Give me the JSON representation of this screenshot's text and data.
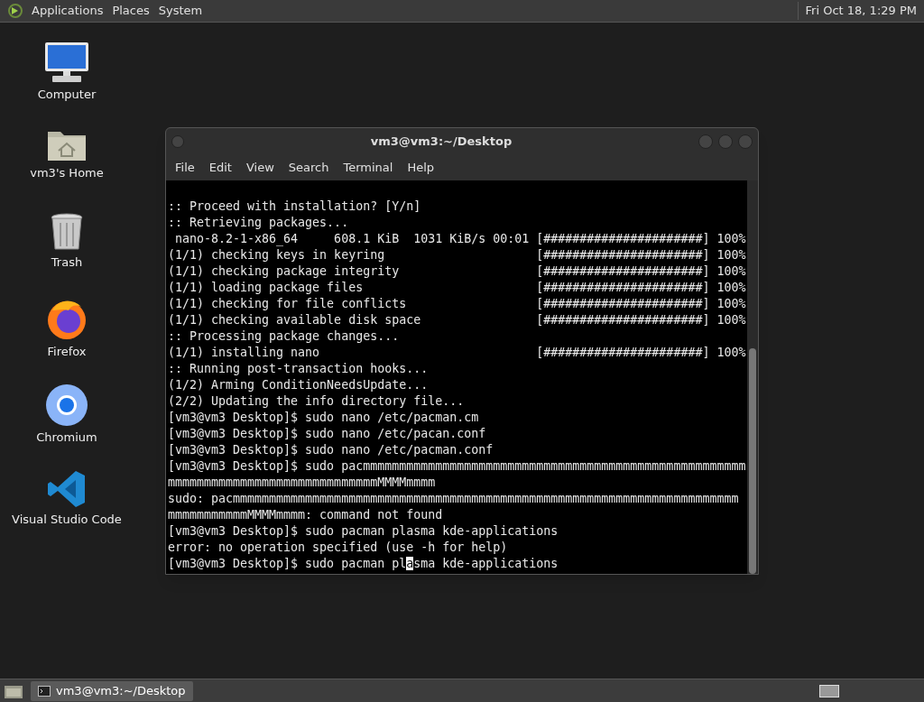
{
  "top_panel": {
    "menus": [
      "Applications",
      "Places",
      "System"
    ],
    "clock": "Fri Oct 18, 1:29 PM"
  },
  "desktop_icons": [
    {
      "kind": "computer",
      "label": "Computer"
    },
    {
      "kind": "home",
      "label": "vm3's Home"
    },
    {
      "kind": "trash",
      "label": "Trash"
    },
    {
      "kind": "firefox",
      "label": "Firefox"
    },
    {
      "kind": "chromium",
      "label": "Chromium"
    },
    {
      "kind": "vscode",
      "label": "Visual Studio Code"
    }
  ],
  "window": {
    "title": "vm3@vm3:~/Desktop",
    "menu": [
      "File",
      "Edit",
      "View",
      "Search",
      "Terminal",
      "Help"
    ],
    "lines": [
      ":: Proceed with installation? [Y/n]",
      ":: Retrieving packages...",
      " nano-8.2-1-x86_64     608.1 KiB  1031 KiB/s 00:01 [######################] 100%",
      "(1/1) checking keys in keyring                     [######################] 100%",
      "(1/1) checking package integrity                   [######################] 100%",
      "(1/1) loading package files                        [######################] 100%",
      "(1/1) checking for file conflicts                  [######################] 100%",
      "(1/1) checking available disk space                [######################] 100%",
      ":: Processing package changes...",
      "(1/1) installing nano                              [######################] 100%",
      ":: Running post-transaction hooks...",
      "(1/2) Arming ConditionNeedsUpdate...",
      "(2/2) Updating the info directory file...",
      "[vm3@vm3 Desktop]$ sudo nano /etc/pacman.cm",
      "[vm3@vm3 Desktop]$ sudo nano /etc/pacan.conf",
      "[vm3@vm3 Desktop]$ sudo nano /etc/pacman.conf",
      "[vm3@vm3 Desktop]$ sudo pacmmmmmmmmmmmmmmmmmmmmmmmmmmmmmmmmmmmmmmmmmmmmmmmmmmmmm",
      "mmmmmmmmmmmmmmmmmmmmmmmmmmmmmMMMMmmmm",
      "sudo: pacmmmmmmmmmmmmmmmmmmmmmmmmmmmmmmmmmmmmmmmmmmmmmmmmmmmmmmmmmmmmmmmmmmmmmm",
      "mmmmmmmmmmmMMMMmmmm: command not found",
      "[vm3@vm3 Desktop]$ sudo pacman plasma kde-applications",
      "error: no operation specified (use -h for help)"
    ],
    "prompt": {
      "before_cursor": "[vm3@vm3 Desktop]$ sudo pacman pl",
      "cursor_char": "a",
      "after_cursor": "sma kde-applications"
    }
  },
  "taskbar": {
    "tasks": [
      {
        "label": "vm3@vm3:~/Desktop",
        "selected": true
      }
    ]
  }
}
